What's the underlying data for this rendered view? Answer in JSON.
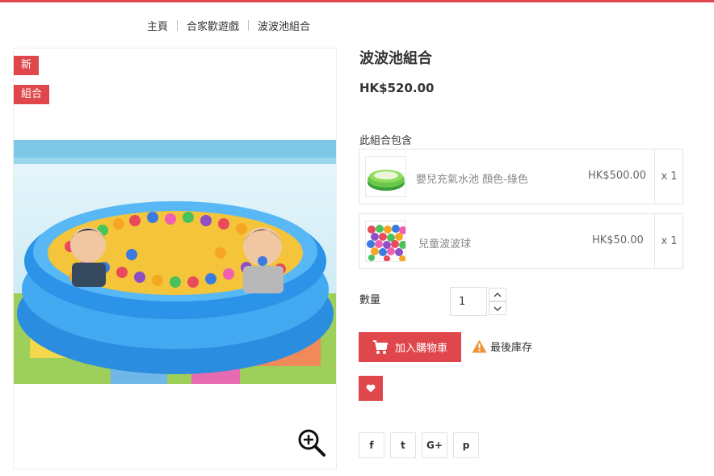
{
  "colors": {
    "accent": "#e0474c",
    "border": "#e5e5e5",
    "muted_text": "#888888"
  },
  "breadcrumb": {
    "items": [
      "主頁",
      "合家歡遊戲",
      "波波池組合"
    ]
  },
  "badges": {
    "new": "新",
    "pack": "組合"
  },
  "product": {
    "title": "波波池組合",
    "price": "HK$520.00",
    "image": {
      "description_icon": "ball-pool-photo"
    }
  },
  "pack": {
    "label": "此組合包含",
    "items": [
      {
        "name": "嬰兒充氣水池 顏色-綠色",
        "price": "HK$500.00",
        "qty": "x 1"
      },
      {
        "name": "兒童波波球",
        "price": "HK$50.00",
        "qty": "x 1"
      }
    ]
  },
  "quantity": {
    "label": "數量",
    "value": "1"
  },
  "actions": {
    "add_to_cart": "加入購物車",
    "stock_status": "最後庫存"
  },
  "icons": {
    "zoom": "zoom-in-icon",
    "cart": "shopping-cart-icon",
    "warning": "warning-icon",
    "wishlist": "heart-icon",
    "social": [
      "facebook-icon",
      "twitter-icon",
      "google-plus-icon",
      "pinterest-icon"
    ]
  },
  "social": {
    "facebook": "f",
    "twitter": "t",
    "google": "G+",
    "pinterest": "p"
  }
}
